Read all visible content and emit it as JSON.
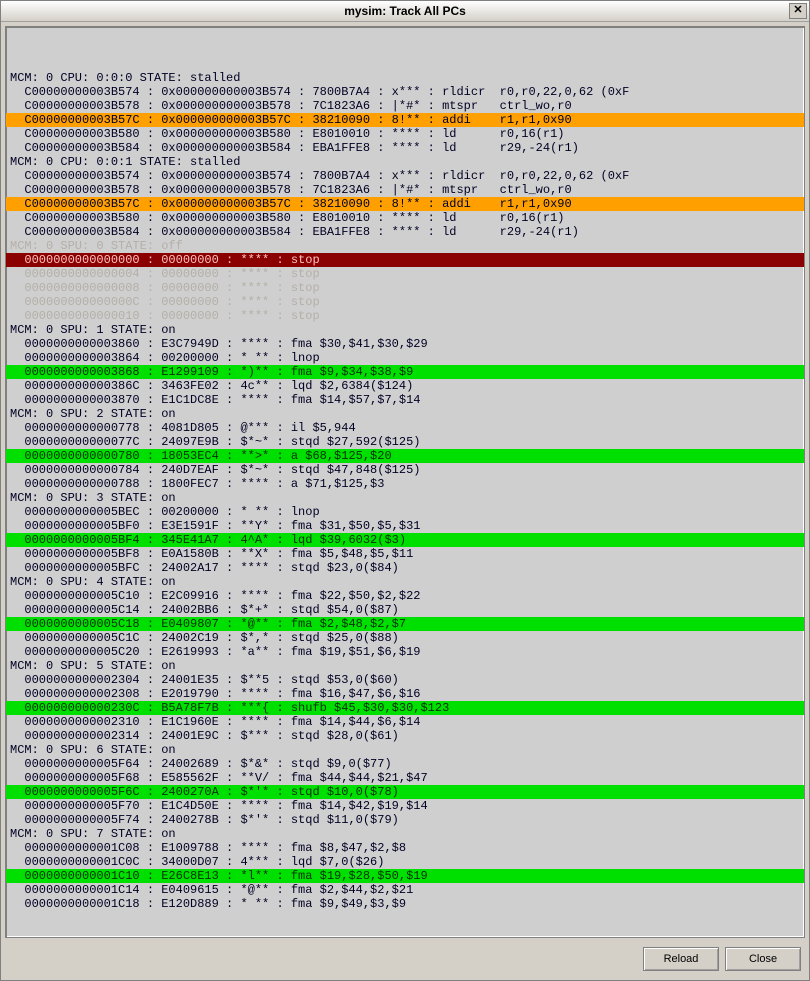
{
  "window": {
    "title": "mysim: Track All PCs",
    "close_glyph": "✕"
  },
  "buttons": {
    "reload": "Reload",
    "close": "Close"
  },
  "groups": [
    {
      "header": "MCM: 0 CPU: 0:0:0 STATE: stalled",
      "dim": false,
      "rows": [
        {
          "text": "  C00000000003B574 : 0x000000000003B574 : 7800B7A4 : x*** : rldicr  r0,r0,22,0,62 (0xF",
          "hl": ""
        },
        {
          "text": "  C00000000003B578 : 0x000000000003B578 : 7C1823A6 : |*#* : mtspr   ctrl_wo,r0",
          "hl": ""
        },
        {
          "text": "  C00000000003B57C : 0x000000000003B57C : 38210090 : 8!** : addi    r1,r1,0x90",
          "hl": "orange"
        },
        {
          "text": "  C00000000003B580 : 0x000000000003B580 : E8010010 : **** : ld      r0,16(r1)",
          "hl": ""
        },
        {
          "text": "  C00000000003B584 : 0x000000000003B584 : EBA1FFE8 : **** : ld      r29,-24(r1)",
          "hl": ""
        }
      ]
    },
    {
      "header": "MCM: 0 CPU: 0:0:1 STATE: stalled",
      "dim": false,
      "rows": [
        {
          "text": "  C00000000003B574 : 0x000000000003B574 : 7800B7A4 : x*** : rldicr  r0,r0,22,0,62 (0xF",
          "hl": ""
        },
        {
          "text": "  C00000000003B578 : 0x000000000003B578 : 7C1823A6 : |*#* : mtspr   ctrl_wo,r0",
          "hl": ""
        },
        {
          "text": "  C00000000003B57C : 0x000000000003B57C : 38210090 : 8!** : addi    r1,r1,0x90",
          "hl": "orange"
        },
        {
          "text": "  C00000000003B580 : 0x000000000003B580 : E8010010 : **** : ld      r0,16(r1)",
          "hl": ""
        },
        {
          "text": "  C00000000003B584 : 0x000000000003B584 : EBA1FFE8 : **** : ld      r29,-24(r1)",
          "hl": ""
        }
      ]
    },
    {
      "header": "MCM: 0 SPU: 0 STATE: off",
      "dim": true,
      "rows": [
        {
          "text": "  0000000000000000 : 00000000 : **** : stop",
          "hl": "darkred"
        },
        {
          "text": "  0000000000000004 : 00000000 : **** : stop",
          "hl": "",
          "dim": true
        },
        {
          "text": "  0000000000000008 : 00000000 : **** : stop",
          "hl": "",
          "dim": true
        },
        {
          "text": "  000000000000000C : 00000000 : **** : stop",
          "hl": "",
          "dim": true
        },
        {
          "text": "  0000000000000010 : 00000000 : **** : stop",
          "hl": "",
          "dim": true
        }
      ]
    },
    {
      "header": "MCM: 0 SPU: 1 STATE: on",
      "dim": false,
      "rows": [
        {
          "text": "  0000000000003860 : E3C7949D : **** : fma $30,$41,$30,$29",
          "hl": ""
        },
        {
          "text": "  0000000000003864 : 00200000 : * ** : lnop",
          "hl": ""
        },
        {
          "text": "  0000000000003868 : E1299109 : *)** : fma $9,$34,$38,$9",
          "hl": "green"
        },
        {
          "text": "  000000000000386C : 3463FE02 : 4c** : lqd $2,6384($124)",
          "hl": ""
        },
        {
          "text": "  0000000000003870 : E1C1DC8E : **** : fma $14,$57,$7,$14",
          "hl": ""
        }
      ]
    },
    {
      "header": "MCM: 0 SPU: 2 STATE: on",
      "dim": false,
      "rows": [
        {
          "text": "  0000000000000778 : 4081D805 : @*** : il $5,944",
          "hl": ""
        },
        {
          "text": "  000000000000077C : 24097E9B : $*~* : stqd $27,592($125)",
          "hl": ""
        },
        {
          "text": "  0000000000000780 : 18053EC4 : **>* : a $68,$125,$20",
          "hl": "green"
        },
        {
          "text": "  0000000000000784 : 240D7EAF : $*~* : stqd $47,848($125)",
          "hl": ""
        },
        {
          "text": "  0000000000000788 : 1800FEC7 : **** : a $71,$125,$3",
          "hl": ""
        }
      ]
    },
    {
      "header": "MCM: 0 SPU: 3 STATE: on",
      "dim": false,
      "rows": [
        {
          "text": "  0000000000005BEC : 00200000 : * ** : lnop",
          "hl": ""
        },
        {
          "text": "  0000000000005BF0 : E3E1591F : **Y* : fma $31,$50,$5,$31",
          "hl": ""
        },
        {
          "text": "  0000000000005BF4 : 345E41A7 : 4^A* : lqd $39,6032($3)",
          "hl": "green"
        },
        {
          "text": "  0000000000005BF8 : E0A1580B : **X* : fma $5,$48,$5,$11",
          "hl": ""
        },
        {
          "text": "  0000000000005BFC : 24002A17 : **** : stqd $23,0($84)",
          "hl": ""
        }
      ]
    },
    {
      "header": "MCM: 0 SPU: 4 STATE: on",
      "dim": false,
      "rows": [
        {
          "text": "  0000000000005C10 : E2C09916 : **** : fma $22,$50,$2,$22",
          "hl": ""
        },
        {
          "text": "  0000000000005C14 : 24002BB6 : $*+* : stqd $54,0($87)",
          "hl": ""
        },
        {
          "text": "  0000000000005C18 : E0409807 : *@** : fma $2,$48,$2,$7",
          "hl": "green"
        },
        {
          "text": "  0000000000005C1C : 24002C19 : $*,* : stqd $25,0($88)",
          "hl": ""
        },
        {
          "text": "  0000000000005C20 : E2619993 : *a** : fma $19,$51,$6,$19",
          "hl": ""
        }
      ]
    },
    {
      "header": "MCM: 0 SPU: 5 STATE: on",
      "dim": false,
      "rows": [
        {
          "text": "  0000000000002304 : 24001E35 : $**5 : stqd $53,0($60)",
          "hl": ""
        },
        {
          "text": "  0000000000002308 : E2019790 : **** : fma $16,$47,$6,$16",
          "hl": ""
        },
        {
          "text": "  000000000000230C : B5A78F7B : ***{ : shufb $45,$30,$30,$123",
          "hl": "green"
        },
        {
          "text": "  0000000000002310 : E1C1960E : **** : fma $14,$44,$6,$14",
          "hl": ""
        },
        {
          "text": "  0000000000002314 : 24001E9C : $*** : stqd $28,0($61)",
          "hl": ""
        }
      ]
    },
    {
      "header": "MCM: 0 SPU: 6 STATE: on",
      "dim": false,
      "rows": [
        {
          "text": "  0000000000005F64 : 24002689 : $*&* : stqd $9,0($77)",
          "hl": ""
        },
        {
          "text": "  0000000000005F68 : E585562F : **V/ : fma $44,$44,$21,$47",
          "hl": ""
        },
        {
          "text": "  0000000000005F6C : 2400270A : $*'* : stqd $10,0($78)",
          "hl": "green"
        },
        {
          "text": "  0000000000005F70 : E1C4D50E : **** : fma $14,$42,$19,$14",
          "hl": ""
        },
        {
          "text": "  0000000000005F74 : 2400278B : $*'* : stqd $11,0($79)",
          "hl": ""
        }
      ]
    },
    {
      "header": "MCM: 0 SPU: 7 STATE: on",
      "dim": false,
      "rows": [
        {
          "text": "  0000000000001C08 : E1009788 : **** : fma $8,$47,$2,$8",
          "hl": ""
        },
        {
          "text": "  0000000000001C0C : 34000D07 : 4*** : lqd $7,0($26)",
          "hl": ""
        },
        {
          "text": "  0000000000001C10 : E26C8E13 : *l** : fma $19,$28,$50,$19",
          "hl": "green"
        },
        {
          "text": "  0000000000001C14 : E0409615 : *@** : fma $2,$44,$2,$21",
          "hl": ""
        },
        {
          "text": "  0000000000001C18 : E120D889 : * ** : fma $9,$49,$3,$9",
          "hl": ""
        }
      ]
    }
  ]
}
